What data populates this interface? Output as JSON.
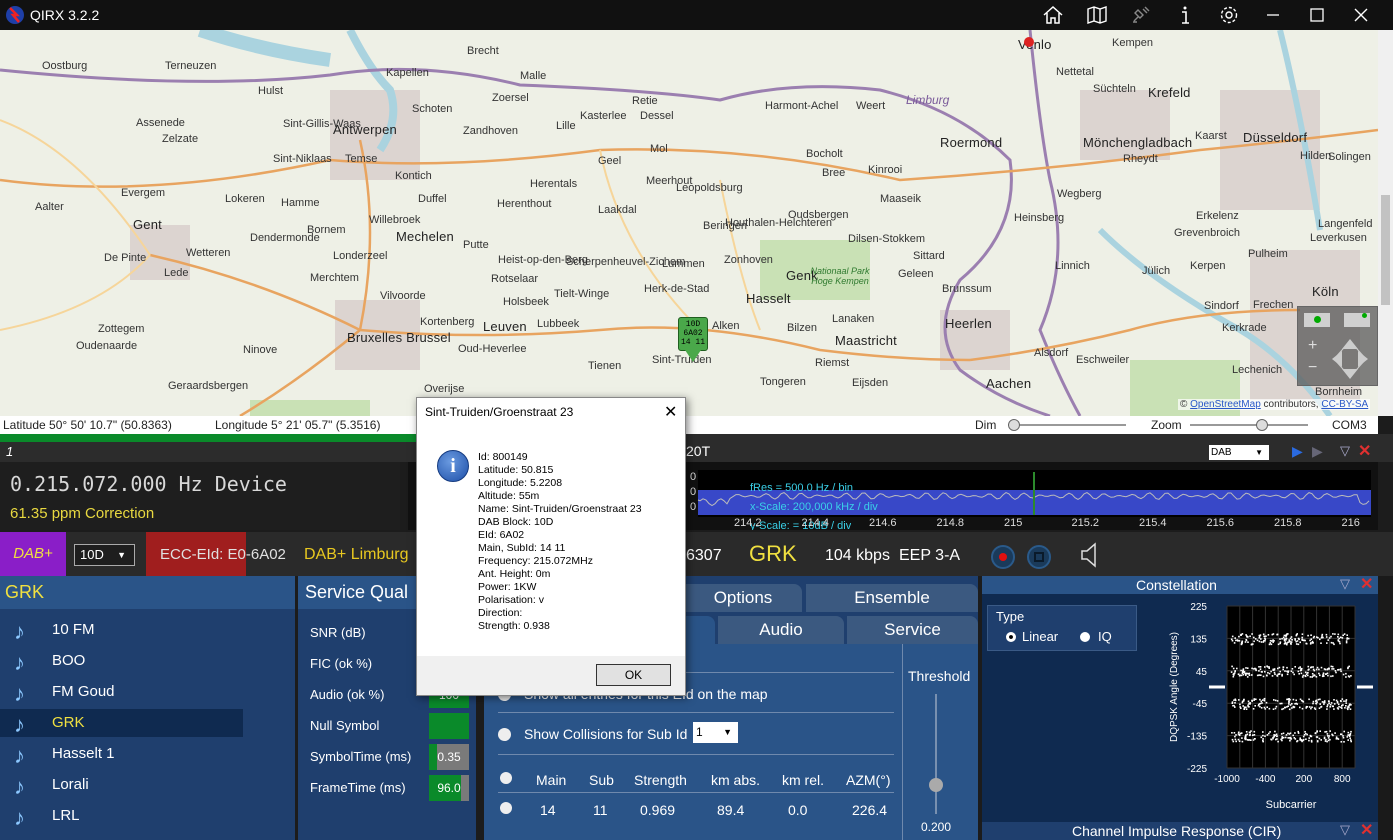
{
  "app": {
    "title": "QIRX 3.2.2"
  },
  "titlebar_icons": [
    "home-icon",
    "map-icon",
    "satellite-icon",
    "info-icon",
    "gear-icon",
    "minimize-icon",
    "maximize-icon",
    "close-icon"
  ],
  "map": {
    "labels": [
      "Oostburg",
      "Terneuzen",
      "Hulst",
      "Brecht",
      "Kapellen",
      "Malle",
      "Zoersel",
      "Schoten",
      "Antwerpen",
      "Sint-Gillis-Waas",
      "Zandhoven",
      "Retie",
      "Lille",
      "Kasterlee",
      "Dessel",
      "Geel",
      "Mol",
      "Harmont-Achel",
      "Weert",
      "Venlo",
      "Kempen",
      "Krefeld",
      "Nettetal",
      "Süchteln",
      "Kaarst",
      "Düsseldorf",
      "Hilden",
      "Mönchengladbach",
      "Roermond",
      "Rheydt",
      "Bocholt",
      "Bree",
      "Kinrooi",
      "Maaseik",
      "Sint-Niklaas",
      "Temse",
      "Lokeren",
      "Mechelen",
      "Duffel",
      "Kontich",
      "Herentals",
      "Herenthout",
      "Meerhout",
      "Leopoldsburg",
      "Beringen",
      "Houthalen-Helchteren",
      "Oudsbergen",
      "Genk",
      "Dilsen-Stokkem",
      "Sittard",
      "Geleen",
      "Gent",
      "Evergem",
      "Aalter",
      "Zelzate",
      "Assenede",
      "Hamme",
      "Bornem",
      "Willebroek",
      "Dendermonde",
      "Wetteren",
      "Lede",
      "De Pinte",
      "Merchtem",
      "Londerzeel",
      "Putte",
      "Heist-op-den-Berg",
      "Laakdal",
      "Scherpenheuvel-Zichem",
      "Lummen",
      "Zonhoven",
      "Herk-de-Stad",
      "Hasselt",
      "Alken",
      "Bilzen",
      "Lanaken",
      "Maastricht",
      "Heerlen",
      "Brunssum",
      "Sint-Truiden",
      "Tienen",
      "Leuven",
      "Holsbeek",
      "Lubbeek",
      "Tielt-Winge",
      "Rotselaar",
      "Vilvoorde",
      "Kortenberg",
      "Bruxelles Brussel",
      "Oud-Heverlee",
      "Overijse",
      "Ninove",
      "Oudenaarde",
      "Geraardsbergen",
      "Zottegem",
      "Tongeren",
      "Riemst",
      "Eijsden",
      "Aachen",
      "Eschweiler",
      "Alsdorf",
      "Kerkrade",
      "Linnich",
      "Jülich",
      "Grevenbroich",
      "Erkelenz",
      "Heinsberg",
      "Wegberg",
      "Kerpen",
      "Frechen",
      "Köln",
      "Bornheim",
      "Lechenich",
      "Sindorf",
      "Pulheim",
      "Leverkusen",
      "Solingen",
      "Langenfeld"
    ],
    "region_limburg": "Limburg",
    "park": "Nationaal Park Hoge Kempen",
    "marker": [
      "10D",
      "6A02",
      "14 11"
    ],
    "attribution_prefix": "©",
    "attribution_link1": "OpenStreetMap",
    "attribution_mid": "contributors,",
    "attribution_link2": "CC-BY-SA"
  },
  "mapbar": {
    "latitude": "Latitude  50° 50' 10.7\" (50.8363)",
    "longitude": "Longitude  5° 21' 05.7\" (5.3516)",
    "dim": "Dim",
    "zoom": "Zoom",
    "port": "COM3",
    "dim_level": 0.0,
    "zoom_level": 0.62
  },
  "dialog": {
    "title": "Sint-Truiden/Groenstraat 23",
    "lines": [
      "Id: 800149",
      "Latitude: 50.815",
      "Longitude: 5.2208",
      "Altitude: 55m",
      "Name: Sint-Truiden/Groenstraat 23",
      "DAB Block: 10D",
      "EId: 6A02",
      "Main, SubId: 14 11",
      "Frequency: 215.072MHz",
      "Ant. Height: 0m",
      "Power: 1KW",
      "Polarisation: v",
      "Direction:",
      "Strength: 0.938"
    ],
    "ok": "OK"
  },
  "device": {
    "index": "1",
    "spec_title": "20T",
    "freq": "0.215.072.000 Hz Device",
    "ppm": "61.35 ppm Correction",
    "mode": "DAB",
    "fres": "fRes = 500.0 Hz / bin",
    "xscale": "x-Scale: 200,000 kHz / div",
    "yscale": "y-Scale: = 10dB / div",
    "spec_ticks": [
      "214.2",
      "214.4",
      "214.6",
      "214.8",
      "215",
      "215.2",
      "215.4",
      "215.6",
      "215.8",
      "216"
    ],
    "spec_yticks": [
      "0",
      "0",
      "0"
    ]
  },
  "servicebar": {
    "dabplus": "DAB+",
    "channel": "10D",
    "ecc": "ECC-EId: E0-6A02",
    "ensemble": "DAB+ Limburg",
    "sid_tail": "6307",
    "service": "GRK",
    "bitrate": "104 kbps",
    "eep": "EEP 3-A"
  },
  "services": {
    "header": "GRK",
    "items": [
      "10 FM",
      "BOO",
      "FM Goud",
      "GRK",
      "Hasselt 1",
      "Lorali",
      "LRL"
    ],
    "selected": 3
  },
  "quality": {
    "header": "Service Qual",
    "rows": [
      {
        "label": "SNR (dB)",
        "value": ""
      },
      {
        "label": "FIC (ok %)",
        "value": ""
      },
      {
        "label": "Audio (ok %)",
        "value": "100"
      },
      {
        "label": "Null Symbol",
        "value": ""
      },
      {
        "label": "SymbolTime (ms)",
        "value": "0.35"
      },
      {
        "label": "FrameTime (ms)",
        "value": "96.0"
      }
    ]
  },
  "tabs": {
    "row1": [
      "Options",
      "Ensemble"
    ],
    "row2": [
      "Audio",
      "Service"
    ],
    "show_all": "Show all entries for this EId on the map",
    "show_collisions": "Show Collisions for Sub Id",
    "sub_id": "1",
    "threshold": "Threshold",
    "threshold_value": "0.200",
    "threshold_level": 0.2,
    "table_headers": [
      "Main",
      "Sub",
      "Strength",
      "km abs.",
      "km rel.",
      "AZM(°)"
    ],
    "table_rows": [
      [
        "14",
        "11",
        "0.969",
        "89.4",
        "0.0",
        "226.4"
      ]
    ]
  },
  "constellation": {
    "title": "Constellation",
    "type_label": "Type",
    "types": [
      "Linear",
      "IQ"
    ],
    "selected_type": "Linear",
    "ylabel": "DQPSK Angle (Degrees)",
    "xlabel": "Subcarrier",
    "yticks": [
      "225",
      "135",
      "45",
      "-45",
      "-135",
      "-225"
    ],
    "xticks": [
      "-1000",
      "-400",
      "200",
      "800"
    ]
  },
  "cir": {
    "title": "Channel Impulse Response (CIR)"
  },
  "chart_data": {
    "type": "scatter",
    "title": "Constellation",
    "xlabel": "Subcarrier",
    "ylabel": "DQPSK Angle (Degrees)",
    "xlim": [
      -1000,
      1000
    ],
    "ylim": [
      -225,
      225
    ],
    "clusters_y": [
      135,
      45,
      -45,
      -135
    ]
  }
}
